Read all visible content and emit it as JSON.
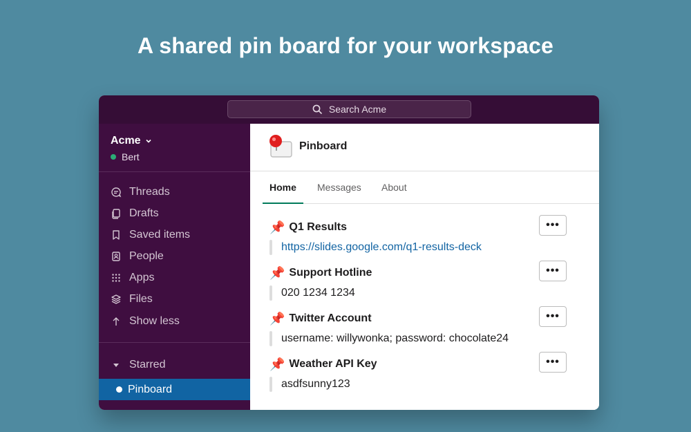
{
  "headline": "A shared pin board for your workspace",
  "search": {
    "placeholder": "Search Acme"
  },
  "workspace": {
    "name": "Acme",
    "user": "Bert",
    "status_color": "#2bac76"
  },
  "sidebar": {
    "items": [
      {
        "label": "Threads",
        "icon": "threads-icon"
      },
      {
        "label": "Drafts",
        "icon": "drafts-icon"
      },
      {
        "label": "Saved items",
        "icon": "bookmark-icon"
      },
      {
        "label": "People",
        "icon": "people-icon"
      },
      {
        "label": "Apps",
        "icon": "apps-grid-icon"
      },
      {
        "label": "Files",
        "icon": "files-layers-icon"
      },
      {
        "label": "Show less",
        "icon": "arrow-up-icon"
      }
    ],
    "section": "Starred",
    "active_channel": "Pinboard"
  },
  "channel": {
    "name": "Pinboard",
    "tabs": [
      {
        "label": "Home",
        "active": true
      },
      {
        "label": "Messages",
        "active": false
      },
      {
        "label": "About",
        "active": false
      }
    ]
  },
  "pins": [
    {
      "emoji": "📌",
      "title": "Q1 Results",
      "body": "https://slides.google.com/q1-results-deck",
      "is_link": true,
      "menu": "•••"
    },
    {
      "emoji": "📌",
      "title": "Support Hotline",
      "body": "020 1234 1234",
      "is_link": false,
      "menu": "•••"
    },
    {
      "emoji": "📌",
      "title": "Twitter Account",
      "body": "username: willywonka; password: chocolate24",
      "is_link": false,
      "menu": "•••"
    },
    {
      "emoji": "📌",
      "title": "Weather API Key",
      "body": "asdfsunny123",
      "is_link": false,
      "menu": "•••"
    }
  ],
  "colors": {
    "background": "#4f8aa0",
    "topbar": "#350d36",
    "sidebar": "#3f0e40",
    "active_item": "#1164a3",
    "link": "#1264a3",
    "tab_underline": "#007a5a"
  }
}
